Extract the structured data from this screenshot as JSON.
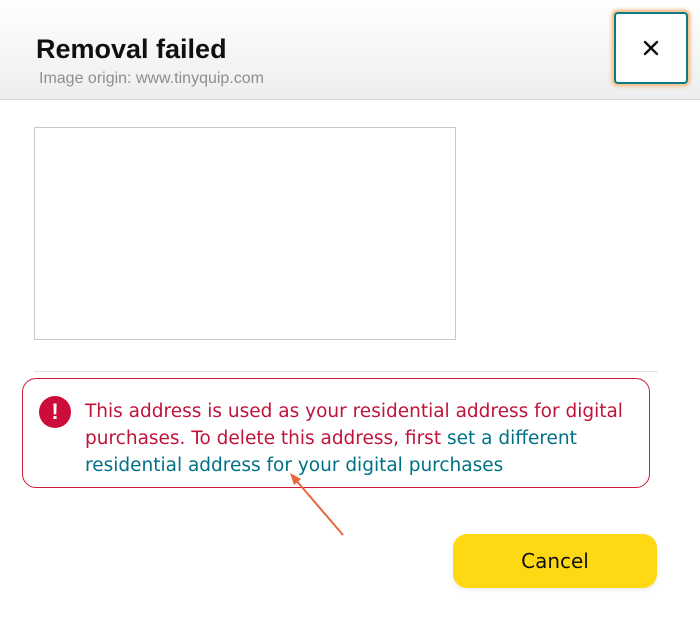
{
  "header": {
    "title": "Removal failed",
    "image_origin": "Image origin: www.tinyquip.com",
    "close_icon": "close-icon",
    "close_label": "×"
  },
  "alert": {
    "icon": "exclamation-icon",
    "icon_glyph": "!",
    "message": "This address is used as your residential address for digital purchases. To delete this address, first ",
    "link_text": "set a different residential address for your digital purchases"
  },
  "footer": {
    "cancel_label": "Cancel"
  },
  "colors": {
    "alert_red": "#cc0c39",
    "link_teal": "#007185",
    "button_yellow": "#ffd814",
    "annotation_arrow": "#e8673c"
  }
}
